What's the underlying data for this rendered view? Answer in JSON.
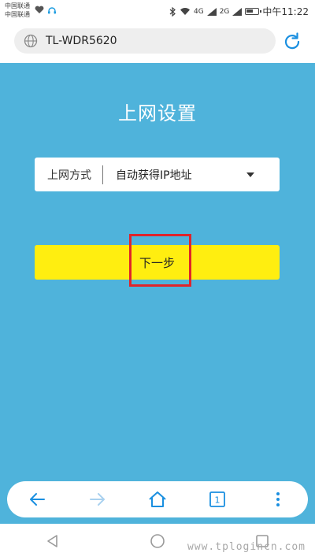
{
  "status_bar": {
    "carrier_1": "中国联通",
    "carrier_2": "中国联通",
    "signal_1": "4G",
    "signal_2": "2G",
    "time": "中午11:22"
  },
  "address_bar": {
    "url": "TL-WDR5620",
    "icons": [
      "globe-icon",
      "reload-icon"
    ]
  },
  "page": {
    "title": "上网设置",
    "connection_type_label": "上网方式",
    "connection_type_value": "自动获得IP地址",
    "next_button_label": "下一步",
    "background_color": "#4fb3db",
    "button_color": "#ffee10",
    "highlight_color": "#e0242a"
  },
  "browser_toolbar": {
    "tab_count": "1",
    "icons": [
      "back-arrow-icon",
      "forward-arrow-icon",
      "home-icon",
      "tabs-icon",
      "more-menu-icon"
    ]
  },
  "nav_bar": {
    "icons": [
      "nav-back-icon",
      "nav-home-icon",
      "nav-recents-icon"
    ]
  },
  "watermark": "www.tplogincn.com"
}
